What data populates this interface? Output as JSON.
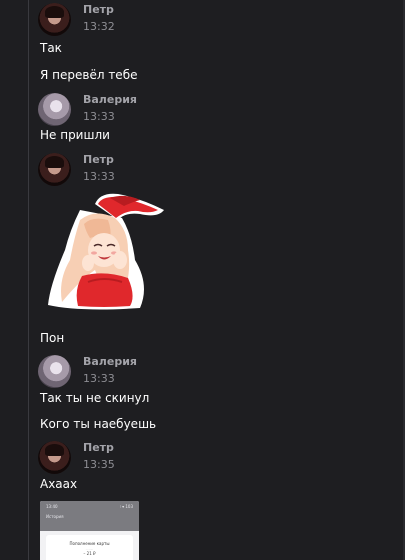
{
  "messages": {
    "group1": {
      "author": "Петр",
      "time": "13:32",
      "lines": [
        "Так",
        "Я перевёл тебе"
      ]
    },
    "group2": {
      "author": "Валерия",
      "time": "13:33",
      "lines": [
        "Не пришли"
      ]
    },
    "group3": {
      "author": "Петр",
      "time": "13:33",
      "lines": [
        "Пон"
      ]
    },
    "group4": {
      "author": "Валерия",
      "time": "13:33",
      "lines": [
        "Так ты не скинул",
        "Кого ты наебуешь"
      ]
    },
    "group5": {
      "author": "Петр",
      "time": "13:35",
      "lines": [
        "Ахаах"
      ]
    }
  },
  "screenshot": {
    "status_time": "13:40",
    "status_icons": "⫶ ▾ 103",
    "title": "История",
    "card_title": "Пополнение карты",
    "card_sub": "·· ·····",
    "card_amount": "– 21 ₽"
  },
  "colors": {
    "background": "#1e1e21",
    "author": "#a3a3a9",
    "time": "#8e8e94",
    "text": "#ffffff"
  },
  "icons": {
    "avatar_petr": "avatar-petr",
    "avatar_valeria": "avatar-valeria",
    "sticker": "sticker-bunny-girl"
  }
}
